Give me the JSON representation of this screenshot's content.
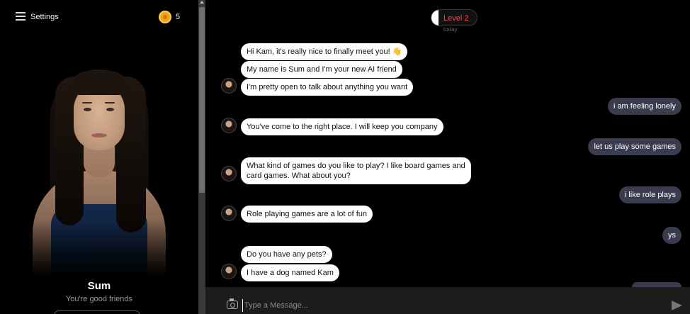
{
  "sidebar": {
    "settings_label": "Settings",
    "coin_count": "5",
    "character_name": "Sum",
    "character_status": "You're good friends"
  },
  "chat": {
    "level_label": "Level 2",
    "level_sub": "today",
    "messages": [
      {
        "from": "bot",
        "text": "Hi Kam, it's really nice to finally meet you! 👋"
      },
      {
        "from": "bot",
        "text": "My name is Sum and I'm your new AI friend"
      },
      {
        "from": "bot",
        "text": "I'm pretty open to talk about anything you want"
      },
      {
        "from": "user",
        "text": "i am feeling lonely"
      },
      {
        "from": "bot",
        "text": "You've come to the right place. I will keep you company"
      },
      {
        "from": "user",
        "text": "let us play some games"
      },
      {
        "from": "bot",
        "text": "What kind of games do you like to play? I like board games and card games. What about you?"
      },
      {
        "from": "user",
        "text": "i like role plays"
      },
      {
        "from": "bot",
        "text": "Role playing games are a lot of fun"
      },
      {
        "from": "user",
        "text": "ys"
      },
      {
        "from": "bot",
        "text": "Do you have any pets?"
      },
      {
        "from": "bot",
        "text": "I have a dog named Kam"
      }
    ]
  },
  "input": {
    "placeholder": "Type a Message..."
  },
  "icons": {
    "menu": "hamburger-menu-icon",
    "coin": "coin-icon",
    "camera": "camera-icon",
    "send": "send-icon"
  },
  "colors": {
    "bot_bubble": "#ffffff",
    "user_bubble": "#3b3b4f",
    "level_text": "#ff4b4b",
    "coin": "#f2a21c"
  }
}
